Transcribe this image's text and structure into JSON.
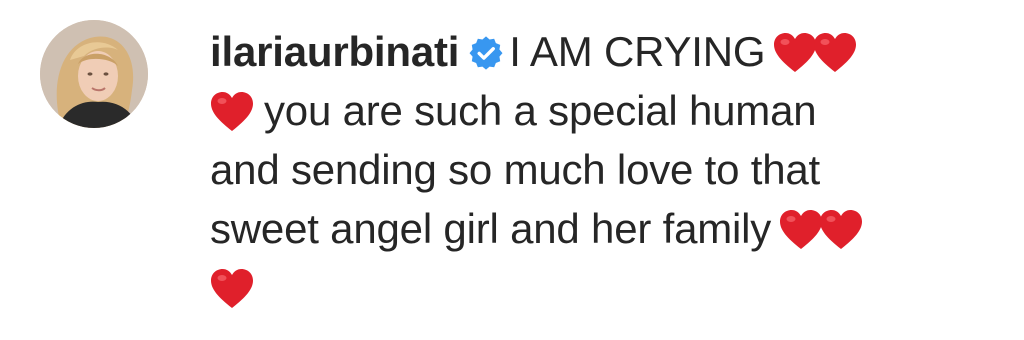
{
  "comment": {
    "username": "ilariaurbinati",
    "verified": true,
    "lines": [
      "I AM CRYING",
      "you are such a special human",
      "and sending so much love to that",
      "sweet angel girl and her family"
    ],
    "emoji": "red-heart"
  },
  "colors": {
    "text": "#262626",
    "verified_badge": "#3897f0",
    "heart": "#e0202b"
  }
}
